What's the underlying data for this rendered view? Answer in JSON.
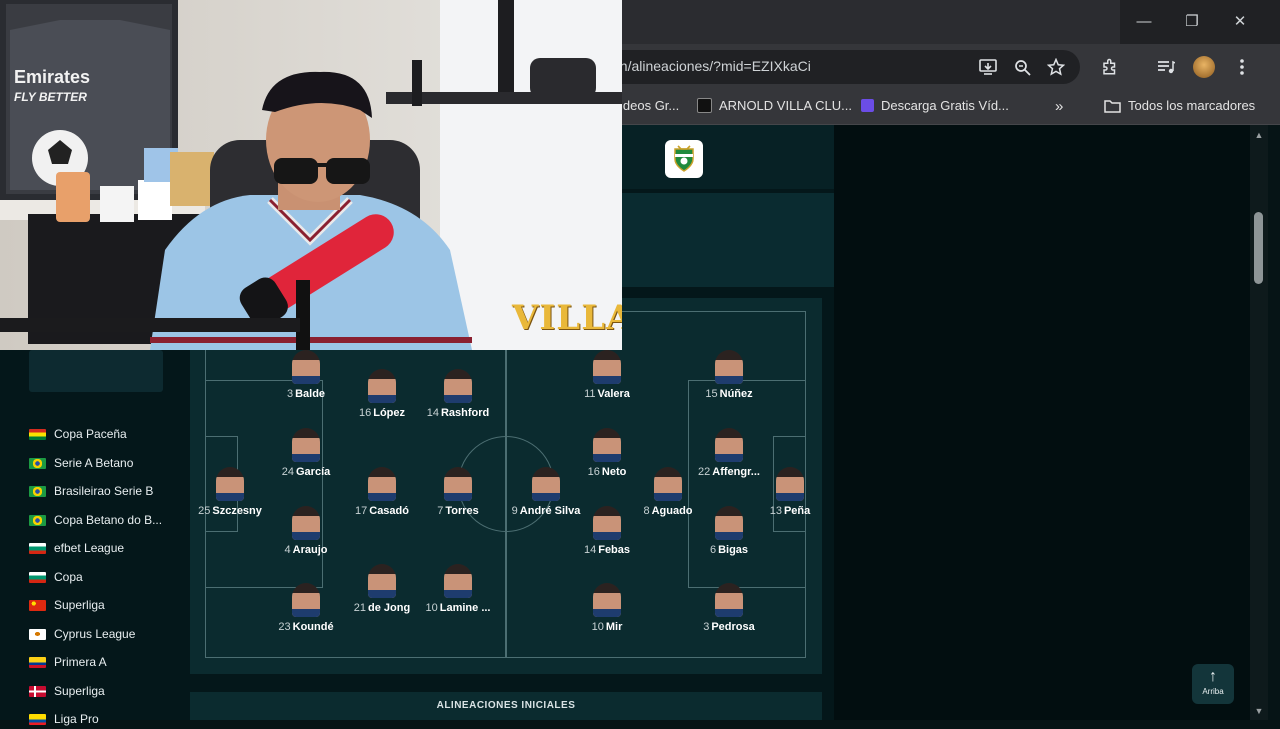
{
  "browser": {
    "url": "en/alineaciones/?mid=EZIXkaCi",
    "bookmarks": [
      "ideos Gr...",
      "ARNOLD VILLA CLU...",
      "Descarga Gratis Víd..."
    ],
    "all_bookmarks_label": "Todos los marcadores",
    "more_bookmarks": "»"
  },
  "window": {
    "minimize": "—",
    "restore": "❐",
    "close": "✕"
  },
  "sidebar": {
    "leagues": [
      {
        "name": "Copa Paceña",
        "flag": "bolivia"
      },
      {
        "name": "Serie A Betano",
        "flag": "brazil"
      },
      {
        "name": "Brasileirao Serie B",
        "flag": "brazil"
      },
      {
        "name": "Copa Betano do B...",
        "flag": "brazil"
      },
      {
        "name": "efbet League",
        "flag": "bulgaria"
      },
      {
        "name": "Copa",
        "flag": "bulgaria"
      },
      {
        "name": "Superliga",
        "flag": "china"
      },
      {
        "name": "Cyprus League",
        "flag": "cyprus"
      },
      {
        "name": "Primera A",
        "flag": "colombia"
      },
      {
        "name": "Superliga",
        "flag": "denmark"
      },
      {
        "name": "Liga Pro",
        "flag": "ecuador"
      }
    ]
  },
  "lineup": {
    "home": [
      {
        "num": "3",
        "name": "Balde"
      },
      {
        "num": "16",
        "name": "López"
      },
      {
        "num": "14",
        "name": "Rashford"
      },
      {
        "num": "24",
        "name": "García"
      },
      {
        "num": "25",
        "name": "Szczesny"
      },
      {
        "num": "17",
        "name": "Casadó"
      },
      {
        "num": "7",
        "name": "Torres"
      },
      {
        "num": "4",
        "name": "Araujo"
      },
      {
        "num": "21",
        "name": "de Jong"
      },
      {
        "num": "10",
        "name": "Lamine ..."
      },
      {
        "num": "23",
        "name": "Koundé"
      }
    ],
    "away": [
      {
        "num": "11",
        "name": "Valera"
      },
      {
        "num": "15",
        "name": "Núñez"
      },
      {
        "num": "16",
        "name": "Neto"
      },
      {
        "num": "22",
        "name": "Affengr..."
      },
      {
        "num": "9",
        "name": "André Silva"
      },
      {
        "num": "8",
        "name": "Aguado"
      },
      {
        "num": "13",
        "name": "Peña"
      },
      {
        "num": "14",
        "name": "Febas"
      },
      {
        "num": "6",
        "name": "Bigas"
      },
      {
        "num": "10",
        "name": "Mir"
      },
      {
        "num": "3",
        "name": "Pedrosa"
      }
    ]
  },
  "sections": {
    "starting_lineups": "ALINEACIONES INICIALES"
  },
  "scroll_top": {
    "label": "Arriba",
    "icon": "arrow-up-icon"
  },
  "webcam": {
    "overlay_text": "VILLA",
    "shirt_text": "Emirates\nFLY BETTER"
  }
}
